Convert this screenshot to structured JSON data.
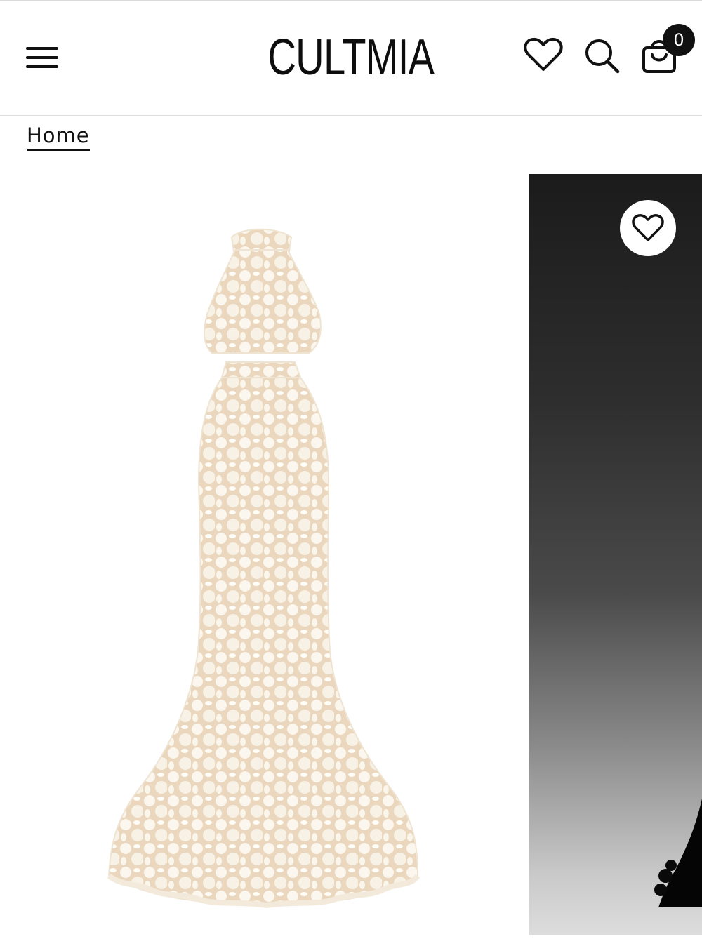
{
  "header": {
    "brand": "CULTMIA",
    "cart_count": "0"
  },
  "breadcrumb": {
    "home_label": "Home"
  },
  "products": [
    {
      "image": "ivory-lace-halter-mermaid-gown",
      "wishlist_icon": "heart-outline-icon"
    },
    {
      "image": "black-gown-dark-backdrop",
      "wishlist_icon": "heart-outline-icon"
    }
  ],
  "colors": {
    "text": "#111111",
    "lace_ivory": "#f7f1e6",
    "lining_nude": "#ead7bd",
    "backdrop_dark": "#1b1b1b"
  }
}
